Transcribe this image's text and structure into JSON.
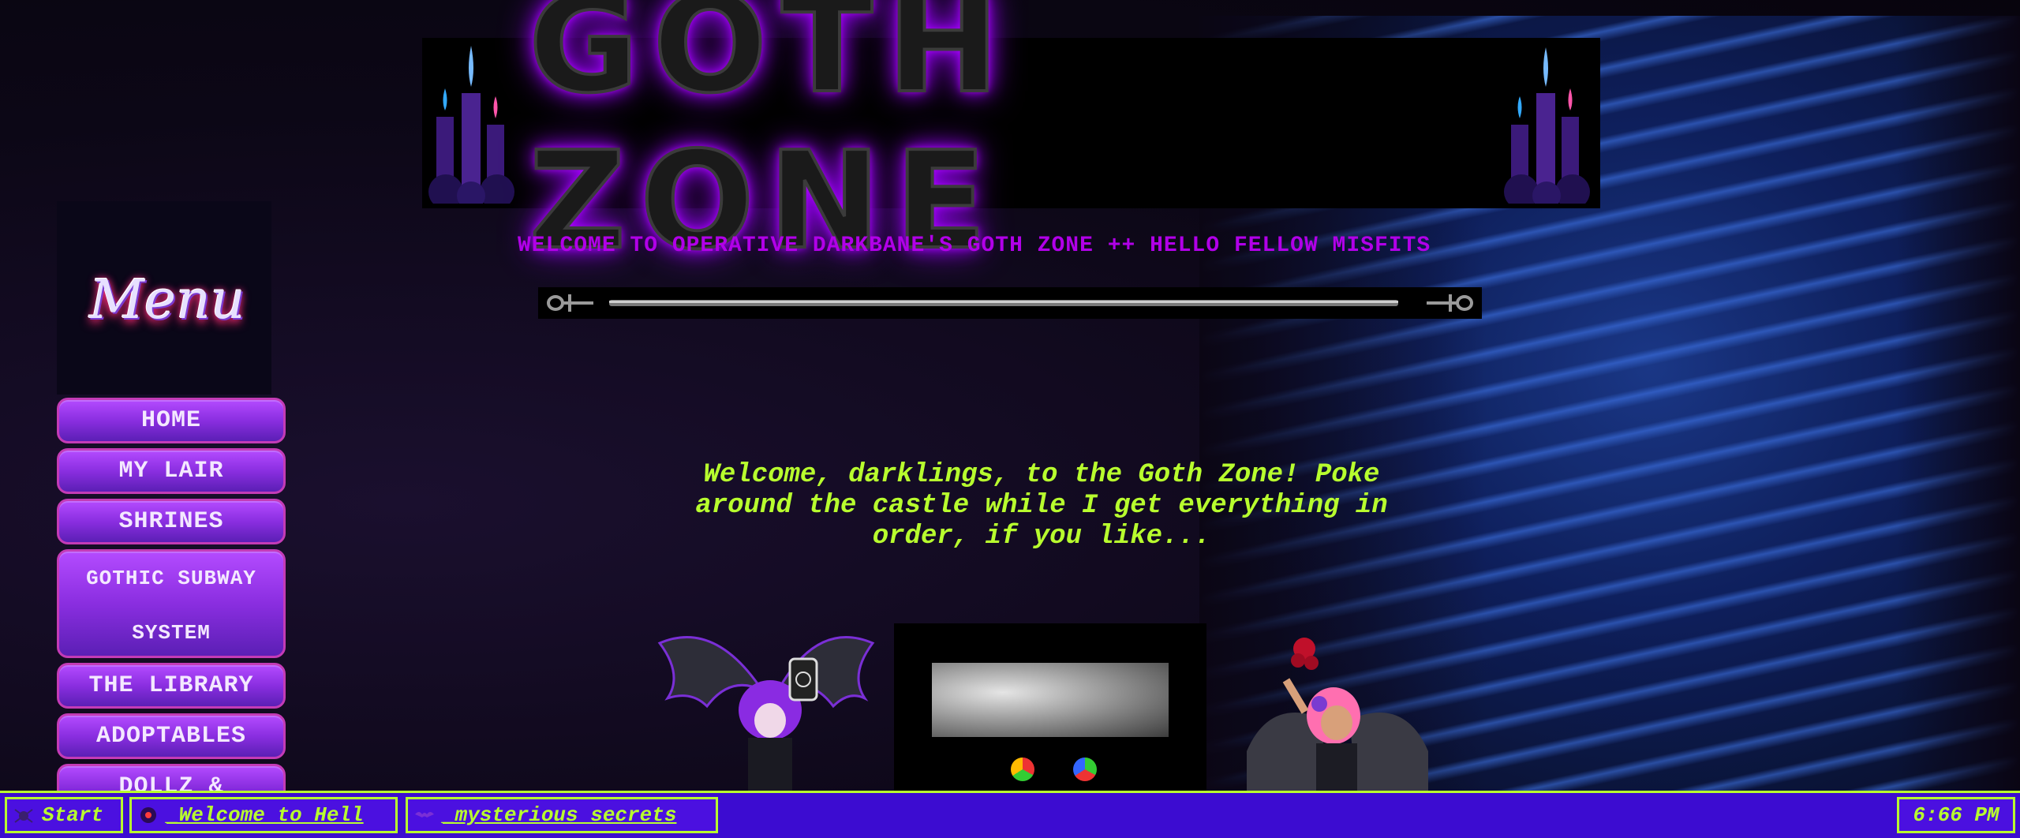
{
  "banner": {
    "title": "GOTH ZONE"
  },
  "marquee": {
    "text": "WELCOME TO OPERATIVE DARKBANE'S GOTH ZONE ++ HELLO FELLOW MISFITS"
  },
  "intro": {
    "text": "Welcome, darklings, to the Goth Zone! Poke\naround the castle while I get everything in\norder, if you like..."
  },
  "sidebar": {
    "menu_logo": "Menu",
    "items": [
      {
        "label": "HOME"
      },
      {
        "label": "MY LAIR"
      },
      {
        "label": "SHRINES"
      },
      {
        "label": "GOTHIC SUBWAY\nSYSTEM"
      },
      {
        "label": "THE LIBRARY"
      },
      {
        "label": "ADOPTABLES"
      },
      {
        "label": "DOLLZ &"
      }
    ]
  },
  "taskbar": {
    "start_label": "Start",
    "windows": [
      {
        "label": "_Welcome to Hell"
      },
      {
        "label": "_mysterious secrets"
      }
    ],
    "clock": "6:66 PM"
  },
  "colors": {
    "accent_green": "#b8ff2e",
    "accent_purple": "#b100e8",
    "taskbar_blue": "#3c0cd1"
  }
}
